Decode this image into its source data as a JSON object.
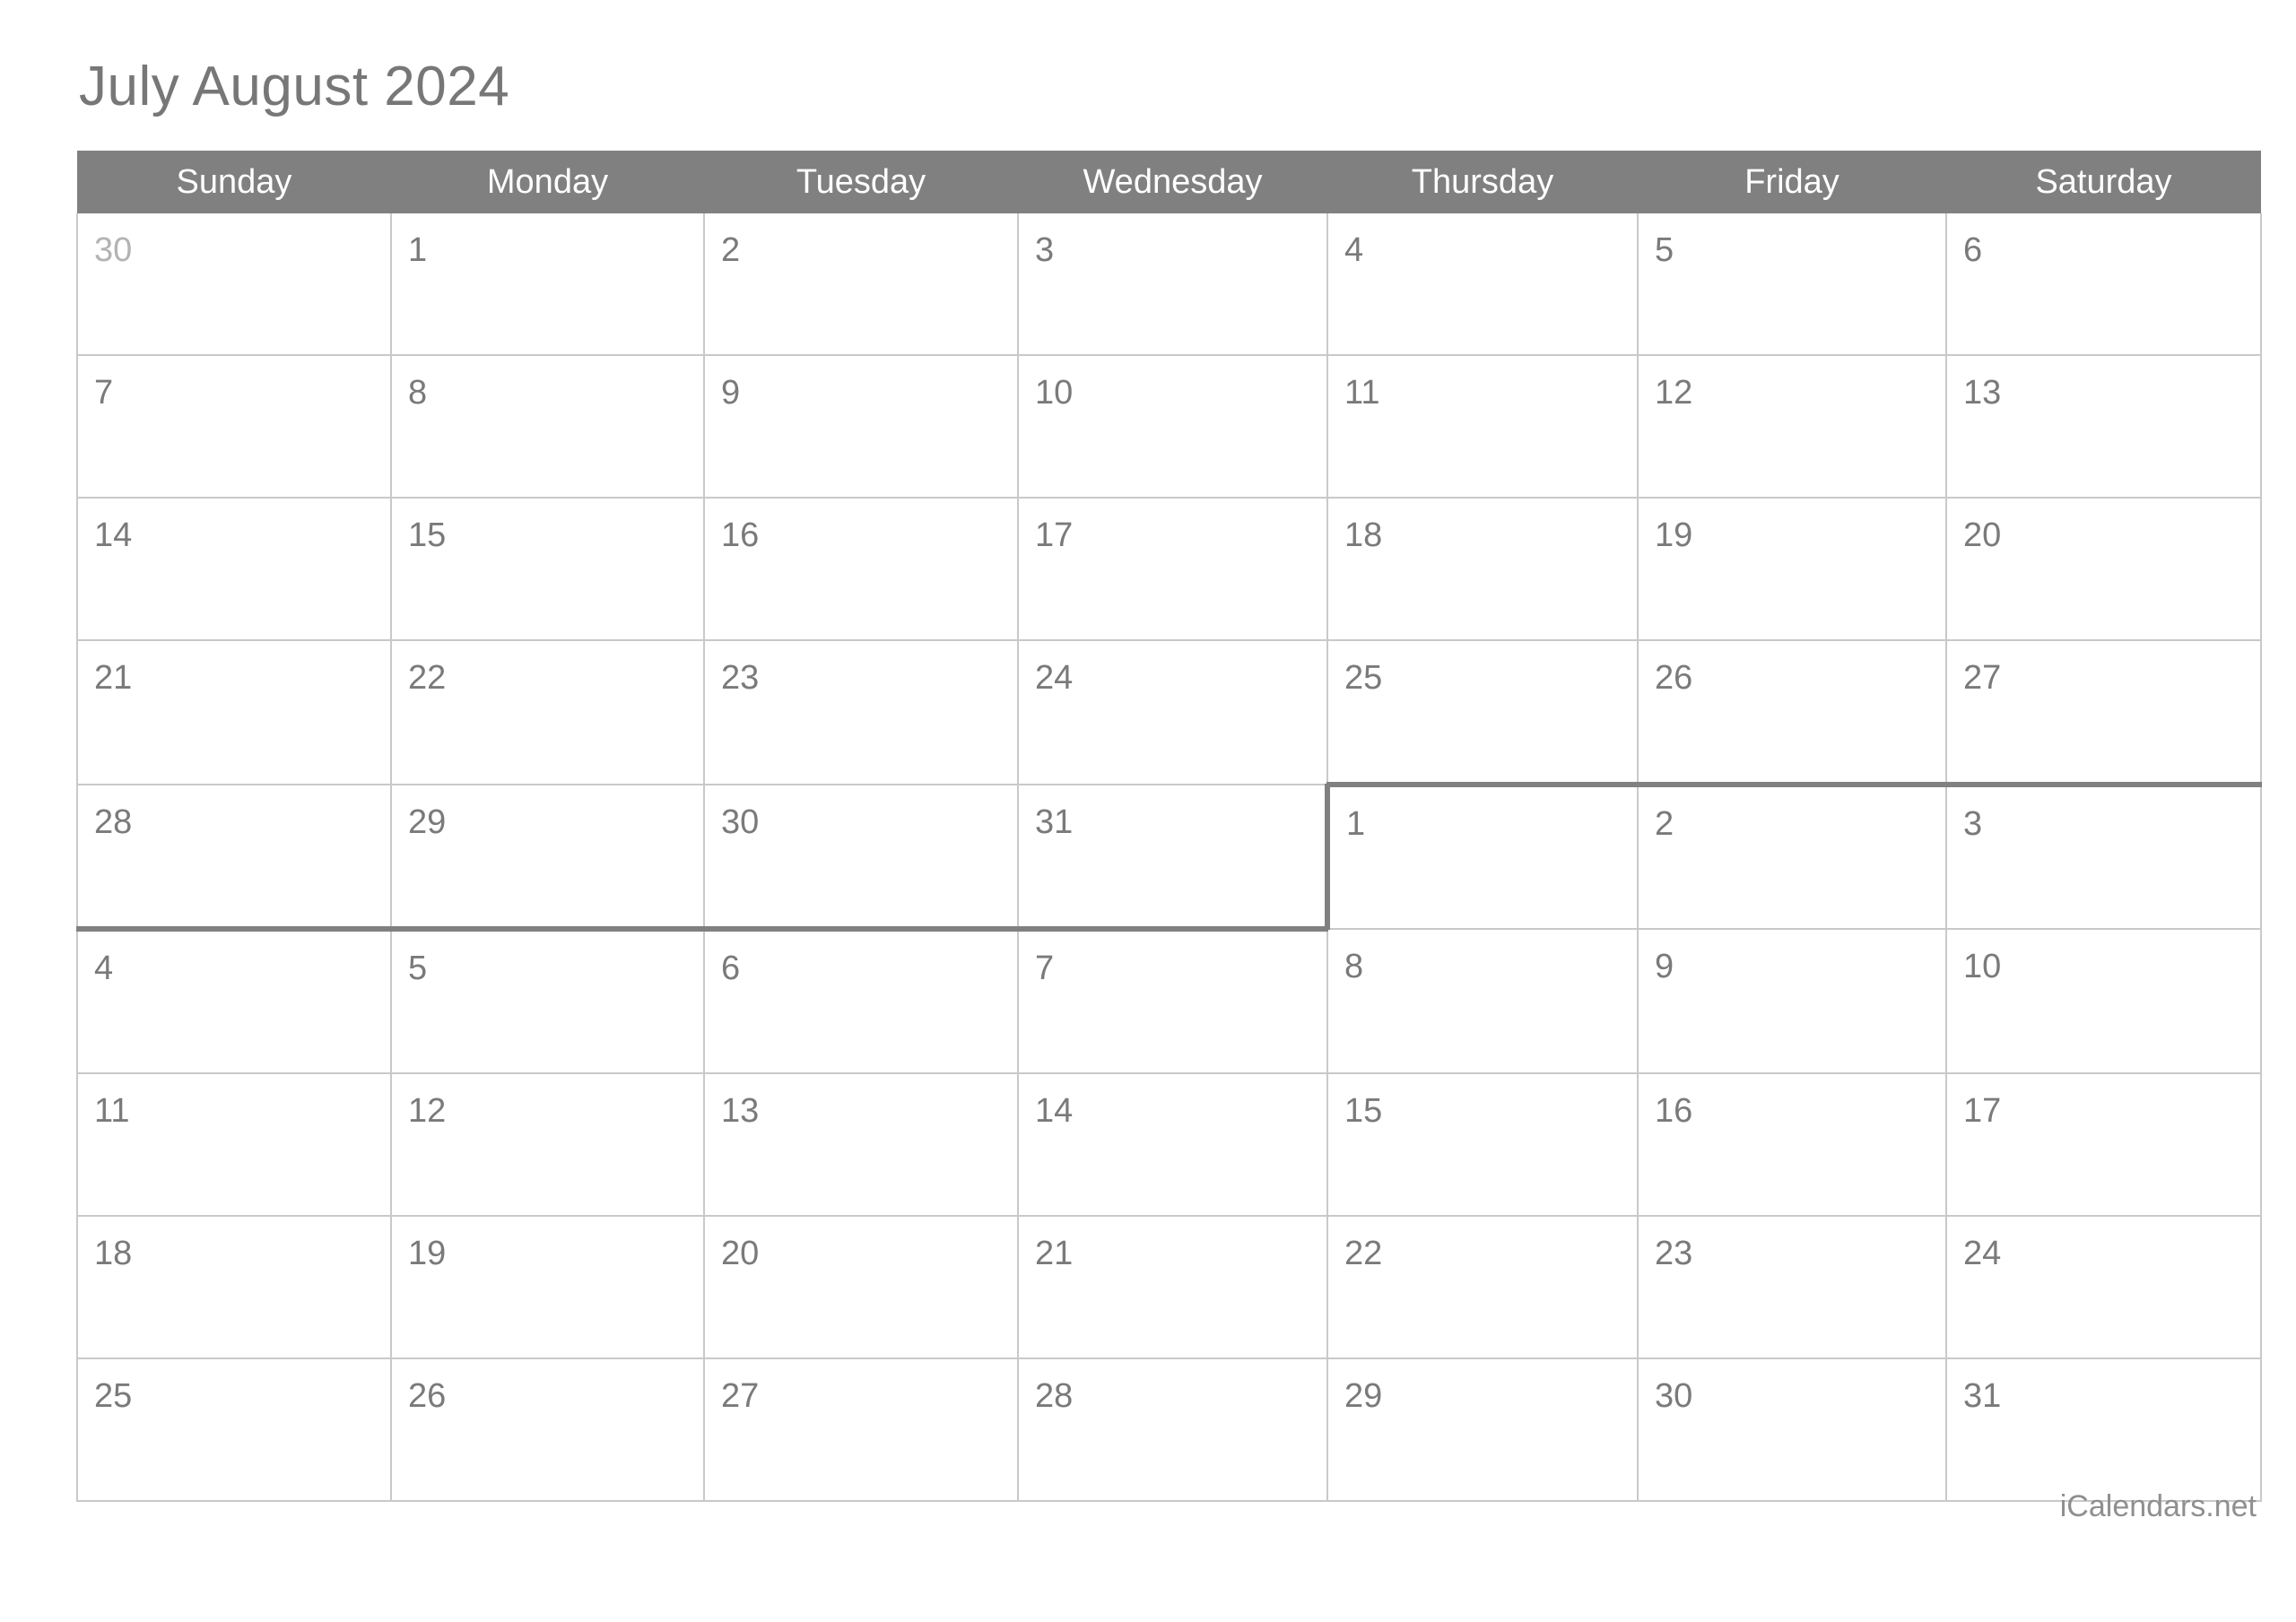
{
  "document": {
    "title": "July August 2024",
    "footer": "iCalendars.net"
  },
  "colors": {
    "header_bg": "#808080",
    "header_text": "#ffffff",
    "grid_line": "#c9c9c9",
    "month_separator": "#808080",
    "day_number": "#7a7a7a",
    "muted_day_number": "#b3b3b3",
    "muted_cell_bg": "#f0f0f0",
    "title_text": "#777777",
    "footer_text": "#8f8f8f",
    "page_bg": "#ffffff"
  },
  "calendar": {
    "weekday_headers": [
      "Sunday",
      "Monday",
      "Tuesday",
      "Wednesday",
      "Thursday",
      "Friday",
      "Saturday"
    ],
    "weeks": [
      {
        "days": [
          {
            "label": "30",
            "muted": true
          },
          {
            "label": "1",
            "muted": false
          },
          {
            "label": "2",
            "muted": false
          },
          {
            "label": "3",
            "muted": false
          },
          {
            "label": "4",
            "muted": false
          },
          {
            "label": "5",
            "muted": false
          },
          {
            "label": "6",
            "muted": false
          }
        ]
      },
      {
        "days": [
          {
            "label": "7",
            "muted": false
          },
          {
            "label": "8",
            "muted": false
          },
          {
            "label": "9",
            "muted": false
          },
          {
            "label": "10",
            "muted": false
          },
          {
            "label": "11",
            "muted": false
          },
          {
            "label": "12",
            "muted": false
          },
          {
            "label": "13",
            "muted": false
          }
        ]
      },
      {
        "days": [
          {
            "label": "14",
            "muted": false
          },
          {
            "label": "15",
            "muted": false
          },
          {
            "label": "16",
            "muted": false
          },
          {
            "label": "17",
            "muted": false
          },
          {
            "label": "18",
            "muted": false
          },
          {
            "label": "19",
            "muted": false
          },
          {
            "label": "20",
            "muted": false
          }
        ]
      },
      {
        "days": [
          {
            "label": "21",
            "muted": false
          },
          {
            "label": "22",
            "muted": false
          },
          {
            "label": "23",
            "muted": false
          },
          {
            "label": "24",
            "muted": false
          },
          {
            "label": "25",
            "muted": false
          },
          {
            "label": "26",
            "muted": false
          },
          {
            "label": "27",
            "muted": false
          }
        ]
      },
      {
        "days": [
          {
            "label": "28",
            "muted": false
          },
          {
            "label": "29",
            "muted": false
          },
          {
            "label": "30",
            "muted": false
          },
          {
            "label": "31",
            "muted": false
          },
          {
            "label": "1",
            "muted": false
          },
          {
            "label": "2",
            "muted": false
          },
          {
            "label": "3",
            "muted": false
          }
        ]
      },
      {
        "days": [
          {
            "label": "4",
            "muted": false
          },
          {
            "label": "5",
            "muted": false
          },
          {
            "label": "6",
            "muted": false
          },
          {
            "label": "7",
            "muted": false
          },
          {
            "label": "8",
            "muted": false
          },
          {
            "label": "9",
            "muted": false
          },
          {
            "label": "10",
            "muted": false
          }
        ]
      },
      {
        "days": [
          {
            "label": "11",
            "muted": false
          },
          {
            "label": "12",
            "muted": false
          },
          {
            "label": "13",
            "muted": false
          },
          {
            "label": "14",
            "muted": false
          },
          {
            "label": "15",
            "muted": false
          },
          {
            "label": "16",
            "muted": false
          },
          {
            "label": "17",
            "muted": false
          }
        ]
      },
      {
        "days": [
          {
            "label": "18",
            "muted": false
          },
          {
            "label": "19",
            "muted": false
          },
          {
            "label": "20",
            "muted": false
          },
          {
            "label": "21",
            "muted": false
          },
          {
            "label": "22",
            "muted": false
          },
          {
            "label": "23",
            "muted": false
          },
          {
            "label": "24",
            "muted": false
          }
        ]
      },
      {
        "days": [
          {
            "label": "25",
            "muted": false
          },
          {
            "label": "26",
            "muted": false
          },
          {
            "label": "27",
            "muted": false
          },
          {
            "label": "28",
            "muted": false
          },
          {
            "label": "29",
            "muted": false
          },
          {
            "label": "30",
            "muted": false
          },
          {
            "label": "31",
            "muted": false
          }
        ]
      }
    ]
  }
}
